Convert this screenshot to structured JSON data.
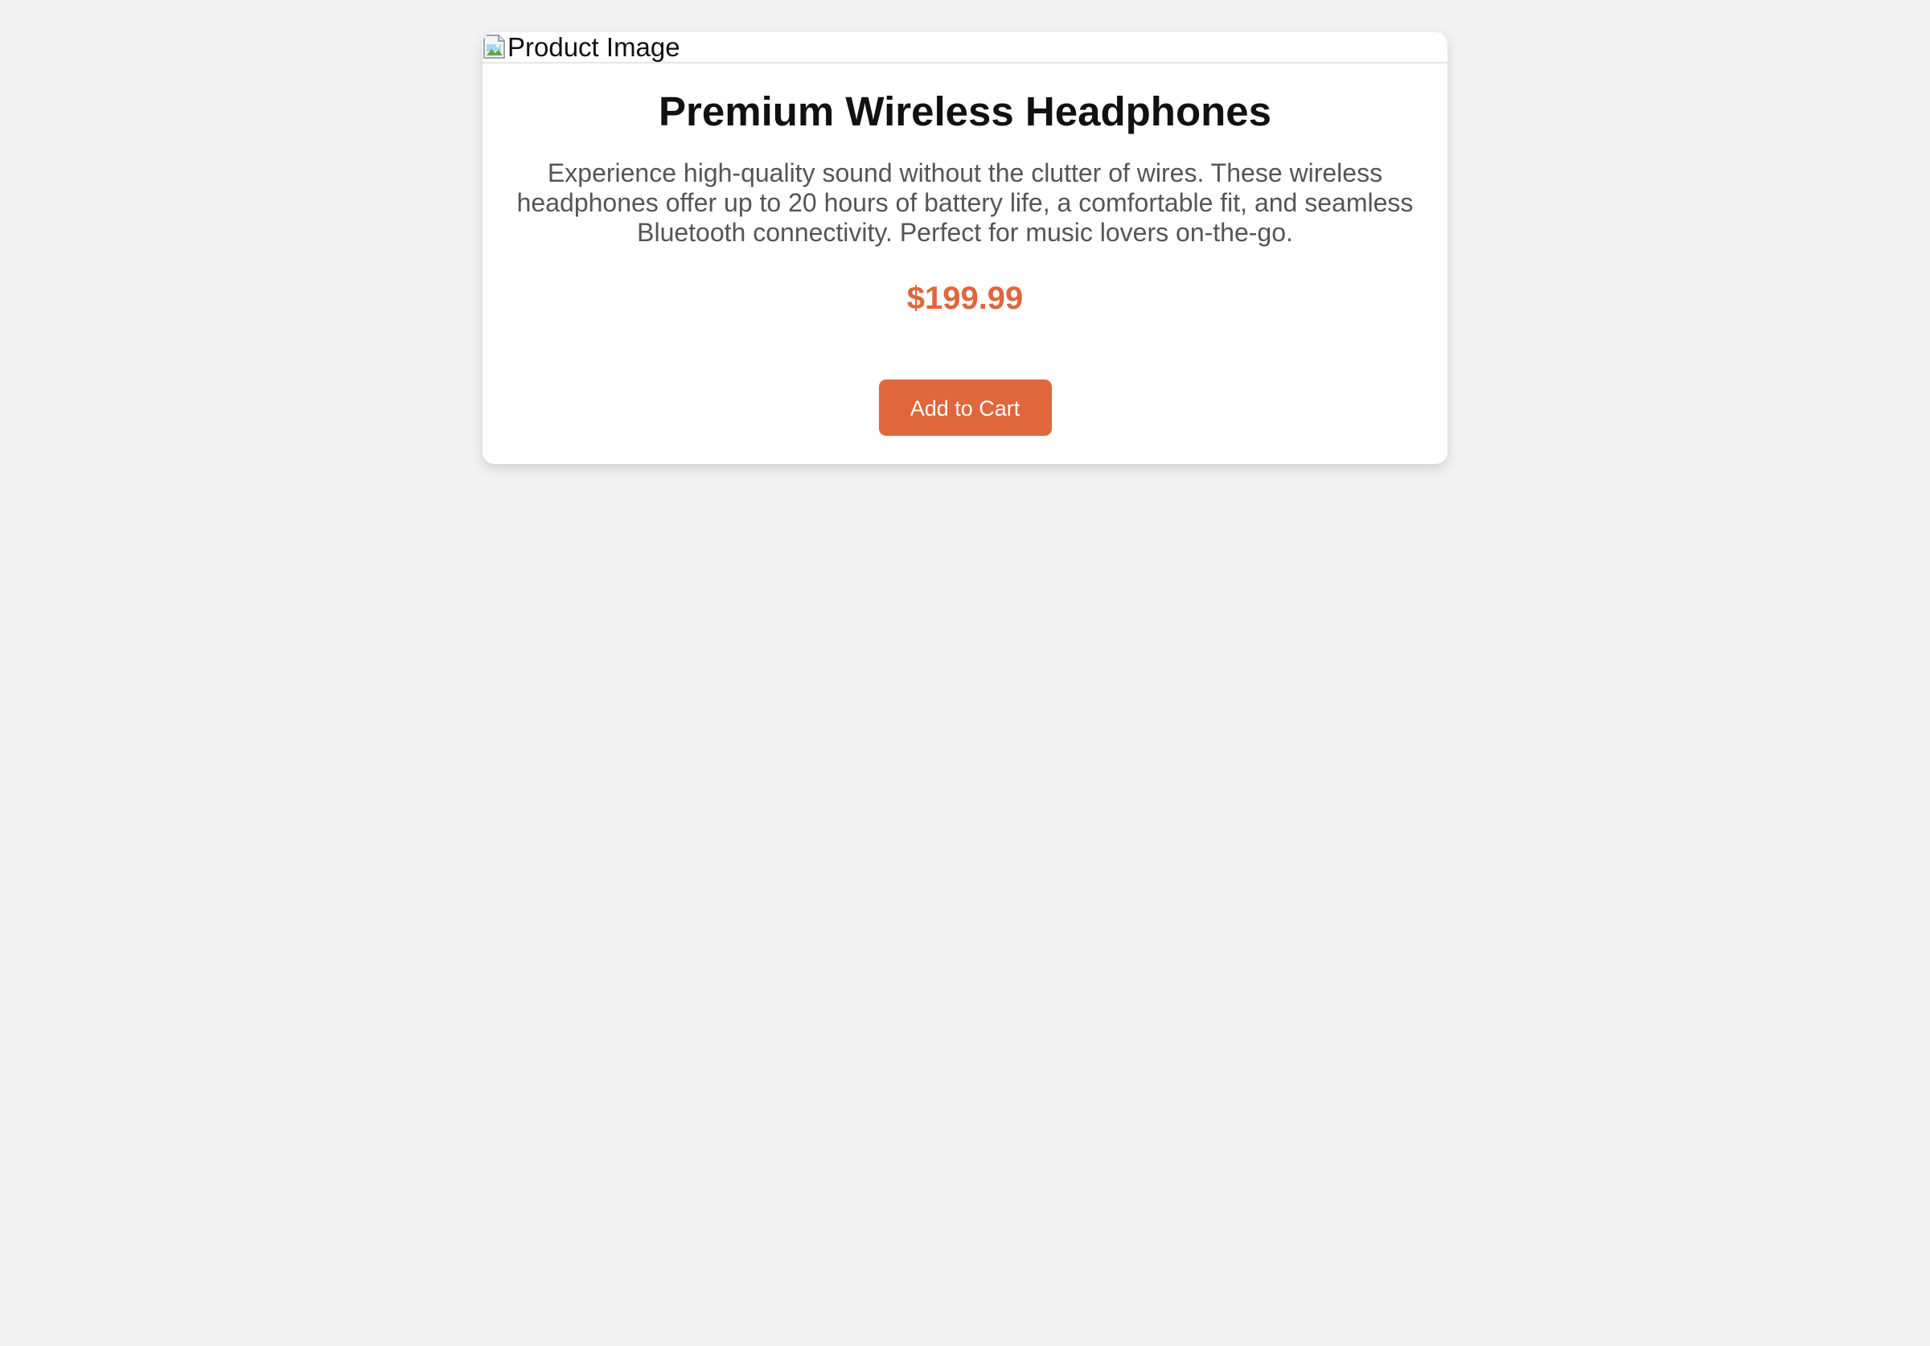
{
  "product": {
    "image_alt": "Product Image",
    "image_icon": "broken-image-icon",
    "title": "Premium Wireless Headphones",
    "description": "Experience high-quality sound without the clutter of wires. These wireless headphones offer up to 20 hours of battery life, a comfortable fit, and seamless Bluetooth connectivity. Perfect for music lovers on-the-go.",
    "price": "$199.99",
    "add_to_cart_label": "Add to Cart"
  },
  "colors": {
    "page_background": "#f3f3f3",
    "card_background": "#ffffff",
    "accent": "#e0663b",
    "title_text": "#111111",
    "description_text": "#555555",
    "button_text": "#ffffff"
  }
}
